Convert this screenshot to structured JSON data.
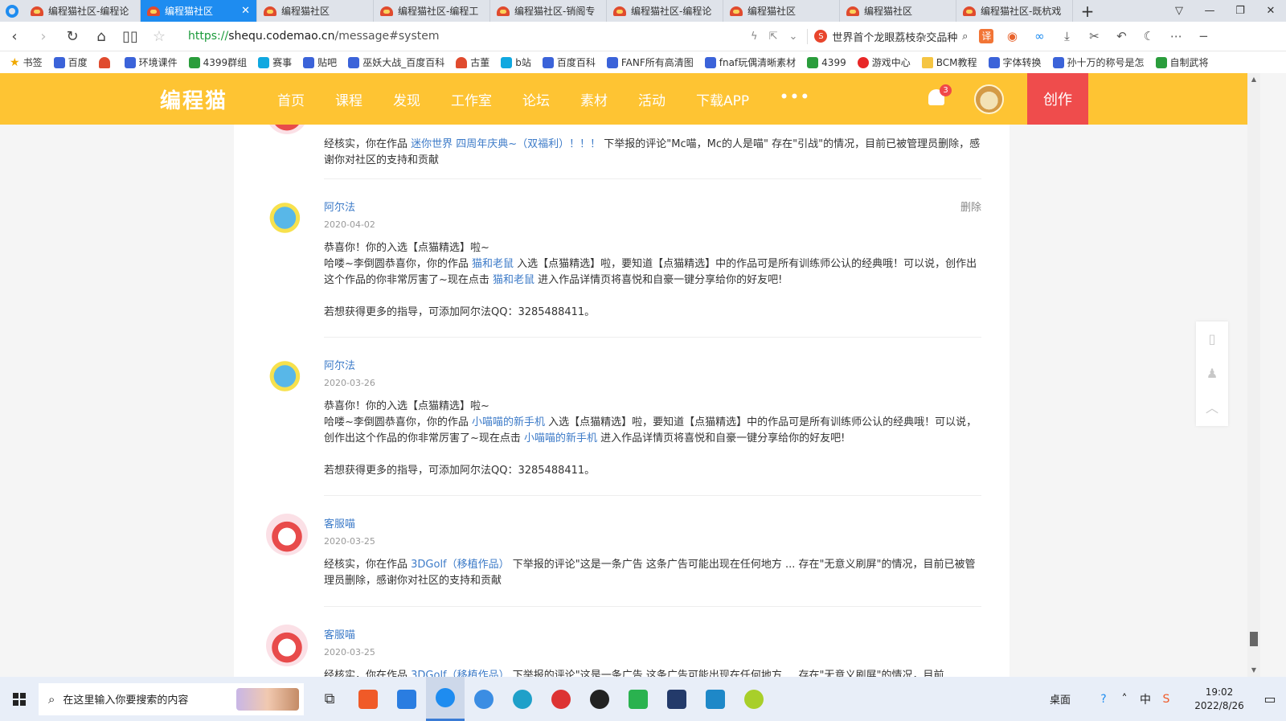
{
  "browser": {
    "tabs": [
      {
        "title": "编程猫社区-编程论",
        "active": false
      },
      {
        "title": "编程猫社区",
        "active": true
      },
      {
        "title": "编程猫社区",
        "active": false
      },
      {
        "title": "编程猫社区-编程工",
        "active": false
      },
      {
        "title": "编程猫社区-销阁专",
        "active": false
      },
      {
        "title": "编程猫社区-编程论",
        "active": false
      },
      {
        "title": "编程猫社区",
        "active": false
      },
      {
        "title": "编程猫社区",
        "active": false
      },
      {
        "title": "编程猫社区-既杭戏",
        "active": false
      }
    ],
    "new_tab": "+",
    "url_scheme": "https://",
    "url_host": "shequ.codemao.cn",
    "url_path": "/message#system",
    "search_logo": "S",
    "search_text": "世界首个龙眼荔枝杂交品种",
    "translate_label": "译"
  },
  "bookmarks": [
    {
      "label": "书签",
      "icon": "star"
    },
    {
      "label": "百度",
      "icon": "paw"
    },
    {
      "label": "",
      "icon": "codemao"
    },
    {
      "label": "环境课件",
      "icon": "paw"
    },
    {
      "label": "4399群组",
      "icon": "grid"
    },
    {
      "label": "赛事",
      "icon": "tv"
    },
    {
      "label": "贴吧",
      "icon": "paw"
    },
    {
      "label": "巫妖大战_百度百科",
      "icon": "paw"
    },
    {
      "label": "古董",
      "icon": "codemao"
    },
    {
      "label": "b站",
      "icon": "tv"
    },
    {
      "label": "百度百科",
      "icon": "paw"
    },
    {
      "label": "FANF所有高清图",
      "icon": "paw"
    },
    {
      "label": "fnaf玩偶清晰素材",
      "icon": "paw"
    },
    {
      "label": "4399",
      "icon": "grid"
    },
    {
      "label": "游戏中心",
      "icon": "circle-red"
    },
    {
      "label": "BCM教程",
      "icon": "folder"
    },
    {
      "label": "字体转换",
      "icon": "gear"
    },
    {
      "label": "孙十万的称号是怎",
      "icon": "zhihu"
    },
    {
      "label": "自制武将",
      "icon": "grid"
    }
  ],
  "site": {
    "logo": "编程猫",
    "nav": [
      "首页",
      "课程",
      "发现",
      "工作室",
      "论坛",
      "素材",
      "活动",
      "下载APP"
    ],
    "nav_more": "•••",
    "notification_count": "3",
    "create_label": "创作"
  },
  "messages": [
    {
      "author": "",
      "date": "",
      "avatar": "kefu",
      "body_parts": [
        {
          "text": "经核实，你在作品 ",
          "link": false
        },
        {
          "text": "迷你世界 四周年庆典~（双福利）！！！",
          "link": true
        },
        {
          "text": " 下举报的评论\"Mc喵，Mc的人是喵\" 存在\"引战\"的情况，目前已被管理员删除，感谢你对社区的支持和贡献",
          "link": false
        }
      ]
    },
    {
      "author": "阿尔法",
      "date": "2020-04-02",
      "avatar": "alfa",
      "delete_label": "删除",
      "title_line": "恭喜你！你的入选【点猫精选】啦~",
      "body_parts": [
        {
          "text": "哈喽~李倒圆恭喜你，你的作品 ",
          "link": false
        },
        {
          "text": "猫和老鼠",
          "link": true
        },
        {
          "text": " 入选【点猫精选】啦，要知道【点猫精选】中的作品可是所有训练师公认的经典哦！可以说，创作出这个作品的你非常厉害了~现在点击 ",
          "link": false
        },
        {
          "text": "猫和老鼠",
          "link": true
        },
        {
          "text": " 进入作品详情页将喜悦和自豪一键分享给你的好友吧!",
          "link": false
        }
      ],
      "footer": "若想获得更多的指导，可添加阿尔法QQ：3285488411。"
    },
    {
      "author": "阿尔法",
      "date": "2020-03-26",
      "avatar": "alfa",
      "title_line": "恭喜你！你的入选【点猫精选】啦~",
      "body_parts": [
        {
          "text": "哈喽~李倒圆恭喜你，你的作品 ",
          "link": false
        },
        {
          "text": "小喵喵的新手机",
          "link": true
        },
        {
          "text": " 入选【点猫精选】啦，要知道【点猫精选】中的作品可是所有训练师公认的经典哦！可以说，创作出这个作品的你非常厉害了~现在点击 ",
          "link": false
        },
        {
          "text": "小喵喵的新手机",
          "link": true
        },
        {
          "text": " 进入作品详情页将喜悦和自豪一键分享给你的好友吧!",
          "link": false
        }
      ],
      "footer": "若想获得更多的指导，可添加阿尔法QQ：3285488411。"
    },
    {
      "author": "客服喵",
      "date": "2020-03-25",
      "avatar": "kefu",
      "body_parts": [
        {
          "text": "经核实，你在作品 ",
          "link": false
        },
        {
          "text": "3DGolf（移植作品）",
          "link": true
        },
        {
          "text": " 下举报的评论\"这是一条广告 这条广告可能出现在任何地方 ... 存在\"无意义刷屏\"的情况，目前已被管理员删除，感谢你对社区的支持和贡献",
          "link": false
        }
      ]
    },
    {
      "author": "客服喵",
      "date": "2020-03-25",
      "avatar": "kefu",
      "body_parts": [
        {
          "text": "经核实，你在作品 ",
          "link": false
        },
        {
          "text": "3DGolf（移植作品）",
          "link": true
        },
        {
          "text": " 下举报的评论\"这是一条广告 这条广告可能出现在任何地方 ... 存在\"无意义刷屏\"的情况，目前",
          "link": false
        }
      ]
    }
  ],
  "taskbar": {
    "search_placeholder": "在这里输入你要搜索的内容",
    "desktop_label": "桌面",
    "ime_label": "中",
    "time": "19:02",
    "date": "2022/8/26",
    "notif_count": "3"
  }
}
